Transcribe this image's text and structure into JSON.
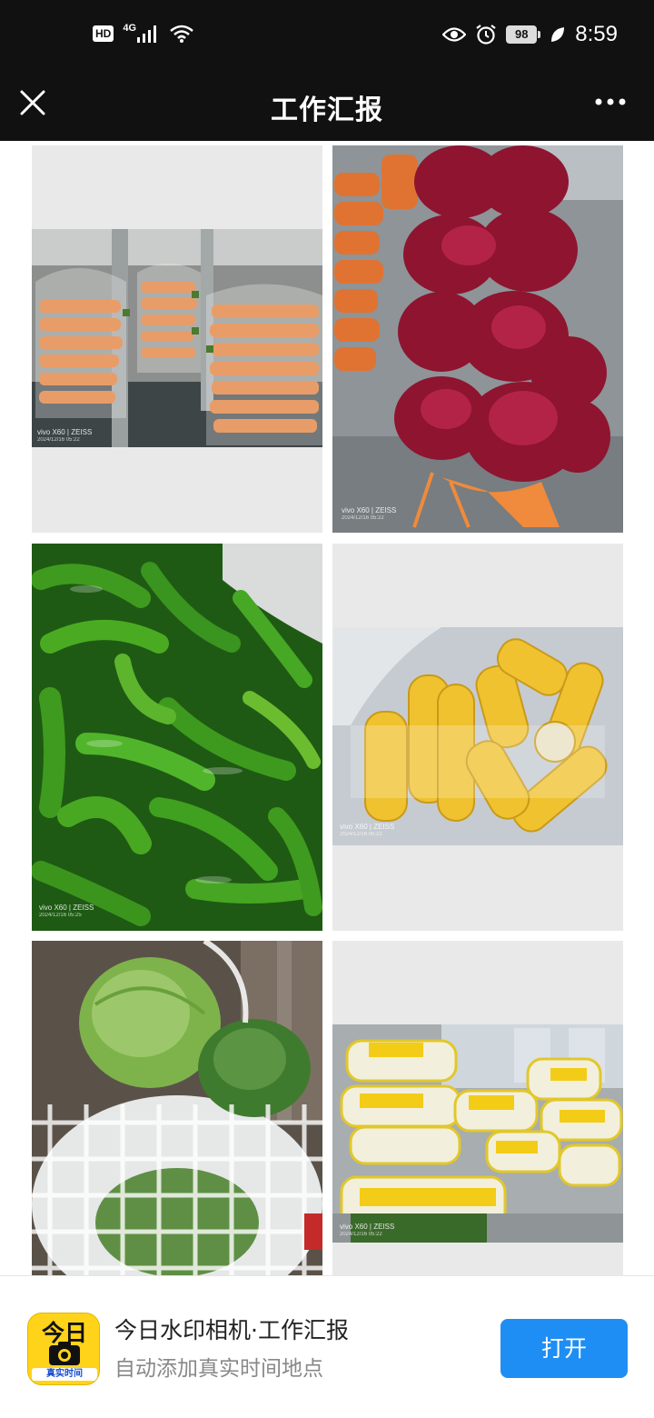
{
  "status_bar": {
    "hd_label": "HD",
    "network_label": "4G",
    "battery_level": "98",
    "time": "8:59",
    "icons": [
      "signal-icon",
      "wifi-icon",
      "eye-icon",
      "alarm-icon",
      "battery-icon",
      "leaf-icon"
    ]
  },
  "nav": {
    "title": "工作汇报",
    "close_icon": "close-icon",
    "more_icon": "more-icon"
  },
  "photos": [
    {
      "subject": "carrots",
      "watermark_brand": "vivo X60 | ZEISS",
      "watermark_date": "2024/12/16 05:22"
    },
    {
      "subject": "red onions",
      "watermark_brand": "vivo X60 | ZEISS",
      "watermark_date": "2024/12/16 05:22"
    },
    {
      "subject": "green peppers",
      "watermark_brand": "vivo X60 | ZEISS",
      "watermark_date": "2024/12/16 05:25"
    },
    {
      "subject": "corn",
      "watermark_brand": "vivo X60 | ZEISS",
      "watermark_date": "2024/12/16 05:22"
    },
    {
      "subject": "cabbage",
      "watermark_brand": "",
      "watermark_date": ""
    },
    {
      "subject": "napa cabbage",
      "watermark_brand": "vivo X60 | ZEISS",
      "watermark_date": "2024/12/16 05:22"
    }
  ],
  "banner": {
    "logo_top": "今日",
    "logo_bottom": "真实时间",
    "app_name": "今日水印相机·工作汇报",
    "app_desc": "自动添加真实时间地点",
    "open_label": "打开"
  },
  "colors": {
    "bar": "#111111",
    "button": "#1e8ef5",
    "logo": "#ffd31a"
  }
}
